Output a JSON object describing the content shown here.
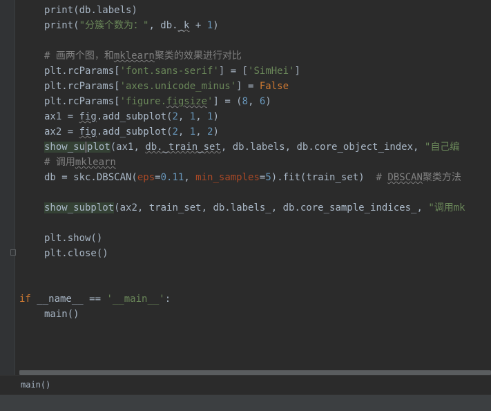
{
  "editor": {
    "lines": {
      "l1_a": "print",
      "l1_b": "(db.labels)",
      "l2_a": "print",
      "l2_b": "(",
      "l2_str": "\"分簇个数为：\"",
      "l2_c": ", db.",
      "l2_k": "_k",
      "l2_d": " + ",
      "l2_num": "1",
      "l2_e": ")",
      "l4_cmt_a": "# 画两个图，和",
      "l4_cmt_b": "mklearn",
      "l4_cmt_c": "聚类的效果进行对比",
      "l5_a": "plt.rcParams[",
      "l5_s1": "'font.sans-serif'",
      "l5_b": "] = [",
      "l5_s2": "'SimHei'",
      "l5_c": "]",
      "l6_a": "plt.rcParams[",
      "l6_s1": "'axes.unicode_minus'",
      "l6_b": "] = ",
      "l6_kw": "False",
      "l7_a": "plt.rcParams[",
      "l7_s1": "'figure.",
      "l7_s2": "figsize",
      "l7_s3": "'",
      "l7_b": "] = (",
      "l7_n1": "8",
      "l7_c": ", ",
      "l7_n2": "6",
      "l7_d": ")",
      "l8_a": "ax1 = ",
      "l8_fig": "fig",
      "l8_b": ".add_subplot(",
      "l8_n1": "2",
      "l8_c1": ", ",
      "l8_n2": "1",
      "l8_c2": ", ",
      "l8_n3": "1",
      "l8_d": ")",
      "l9_a": "ax2 = ",
      "l9_fig": "fig",
      "l9_b": ".add_subplot(",
      "l9_n1": "2",
      "l9_c1": ", ",
      "l9_n2": "1",
      "l9_c2": ", ",
      "l9_n3": "2",
      "l9_d": ")",
      "l10_hl_a": "show_su",
      "l10_hl_b": "plot",
      "l10_a": "(ax1, ",
      "l10_u": "db._train_set",
      "l10_b": ", db.labels, db.core_object_index, ",
      "l10_str": "\"自己编",
      "l11_cmt_a": "# 调用",
      "l11_cmt_b": "mklearn",
      "l12_a": "db = skc.DBSCAN(",
      "l12_p1": "eps",
      "l12_b": "=",
      "l12_n1": "0.11",
      "l12_c": ", ",
      "l12_p2": "min_samples",
      "l12_d": "=",
      "l12_n2": "5",
      "l12_e": ").fit(train_set)  ",
      "l12_cmt_a": "# ",
      "l12_cmt_b": "DBSCAN",
      "l12_cmt_c": "聚类方法",
      "l14_hl": "show_subplot",
      "l14_a": "(ax2, train_set, db.labels_, db.core_sample_indices_, ",
      "l14_str": "\"调用mk",
      "l16": "plt.show()",
      "l17": "plt.close()",
      "l20_kw": "if",
      "l20_a": " __name__ == ",
      "l20_str": "'__main__'",
      "l20_b": ":",
      "l21": "main()"
    }
  },
  "breadcrumb": {
    "label": "main()"
  },
  "colors": {
    "background": "#2b2b2b",
    "keyword": "#cc7832",
    "string": "#6a8759",
    "number": "#6897bb",
    "comment": "#808080",
    "parameter": "#aa4926",
    "text": "#a9b7c6"
  }
}
